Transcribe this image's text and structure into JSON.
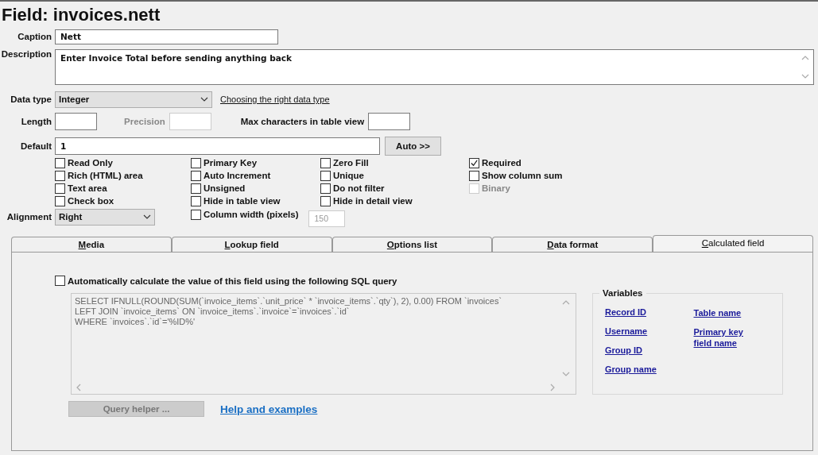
{
  "title": "Field: invoices.nett",
  "caption": {
    "label": "Caption",
    "value": "Nett"
  },
  "description": {
    "label": "Description",
    "value": "Enter Invoice Total before sending anything back"
  },
  "data_type": {
    "label": "Data type",
    "value": "Integer",
    "link": "Choosing the right data type"
  },
  "length": {
    "label": "Length"
  },
  "precision": {
    "label": "Precision",
    "disabled": true
  },
  "max_chars": {
    "label": "Max characters in table view"
  },
  "default": {
    "label": "Default",
    "value": "1",
    "button": "Auto >>"
  },
  "option_columns": [
    [
      {
        "label": "Read Only",
        "checked": false,
        "disabled": false
      },
      {
        "label": "Rich (HTML) area",
        "checked": false,
        "disabled": false
      },
      {
        "label": "Text area",
        "checked": false,
        "disabled": false
      },
      {
        "label": "Check box",
        "checked": false,
        "disabled": false
      }
    ],
    [
      {
        "label": "Primary Key",
        "checked": false,
        "disabled": false
      },
      {
        "label": "Auto Increment",
        "checked": false,
        "disabled": false
      },
      {
        "label": "Unsigned",
        "checked": false,
        "disabled": false
      },
      {
        "label": "Hide in table view",
        "checked": false,
        "disabled": false
      }
    ],
    [
      {
        "label": "Zero Fill",
        "checked": false,
        "disabled": false
      },
      {
        "label": "Unique",
        "checked": false,
        "disabled": false
      },
      {
        "label": "Do not filter",
        "checked": false,
        "disabled": false
      },
      {
        "label": "Hide in detail view",
        "checked": false,
        "disabled": false
      }
    ],
    [
      {
        "label": "Required",
        "checked": true,
        "disabled": false
      },
      {
        "label": "Show column sum",
        "checked": false,
        "disabled": false
      },
      {
        "label": "Binary",
        "checked": false,
        "disabled": true
      }
    ]
  ],
  "alignment": {
    "label": "Alignment",
    "value": "Right"
  },
  "column_width": {
    "label": "Column width (pixels)",
    "checked": false,
    "value": "150",
    "disabled": true
  },
  "tabs": [
    {
      "label": "Media",
      "selected": false
    },
    {
      "label": "Lookup field",
      "selected": false
    },
    {
      "label": "Options list",
      "selected": false
    },
    {
      "label": "Data format",
      "selected": false
    },
    {
      "label": "Calculated field",
      "selected": true
    }
  ],
  "calculated": {
    "checkbox": {
      "label": "Automatically calculate the value of this field using the following SQL query",
      "checked": false
    },
    "sql_lines": [
      "SELECT IFNULL(ROUND(SUM(`invoice_items`.`unit_price` * `invoice_items`.`qty`), 2), 0.00) FROM `invoices`",
      "LEFT JOIN `invoice_items` ON `invoice_items`.`invoice`=`invoices`.`id`",
      "WHERE `invoices`.`id`='%ID%'"
    ],
    "query_helper": {
      "label": "Query helper ...",
      "disabled": true
    },
    "help_link": "Help and examples",
    "variables": {
      "title": "Variables",
      "columns": [
        [
          "Record ID",
          "Username",
          "Group ID",
          "Group name"
        ],
        [
          "Table name",
          "Primary key field name"
        ]
      ]
    }
  }
}
